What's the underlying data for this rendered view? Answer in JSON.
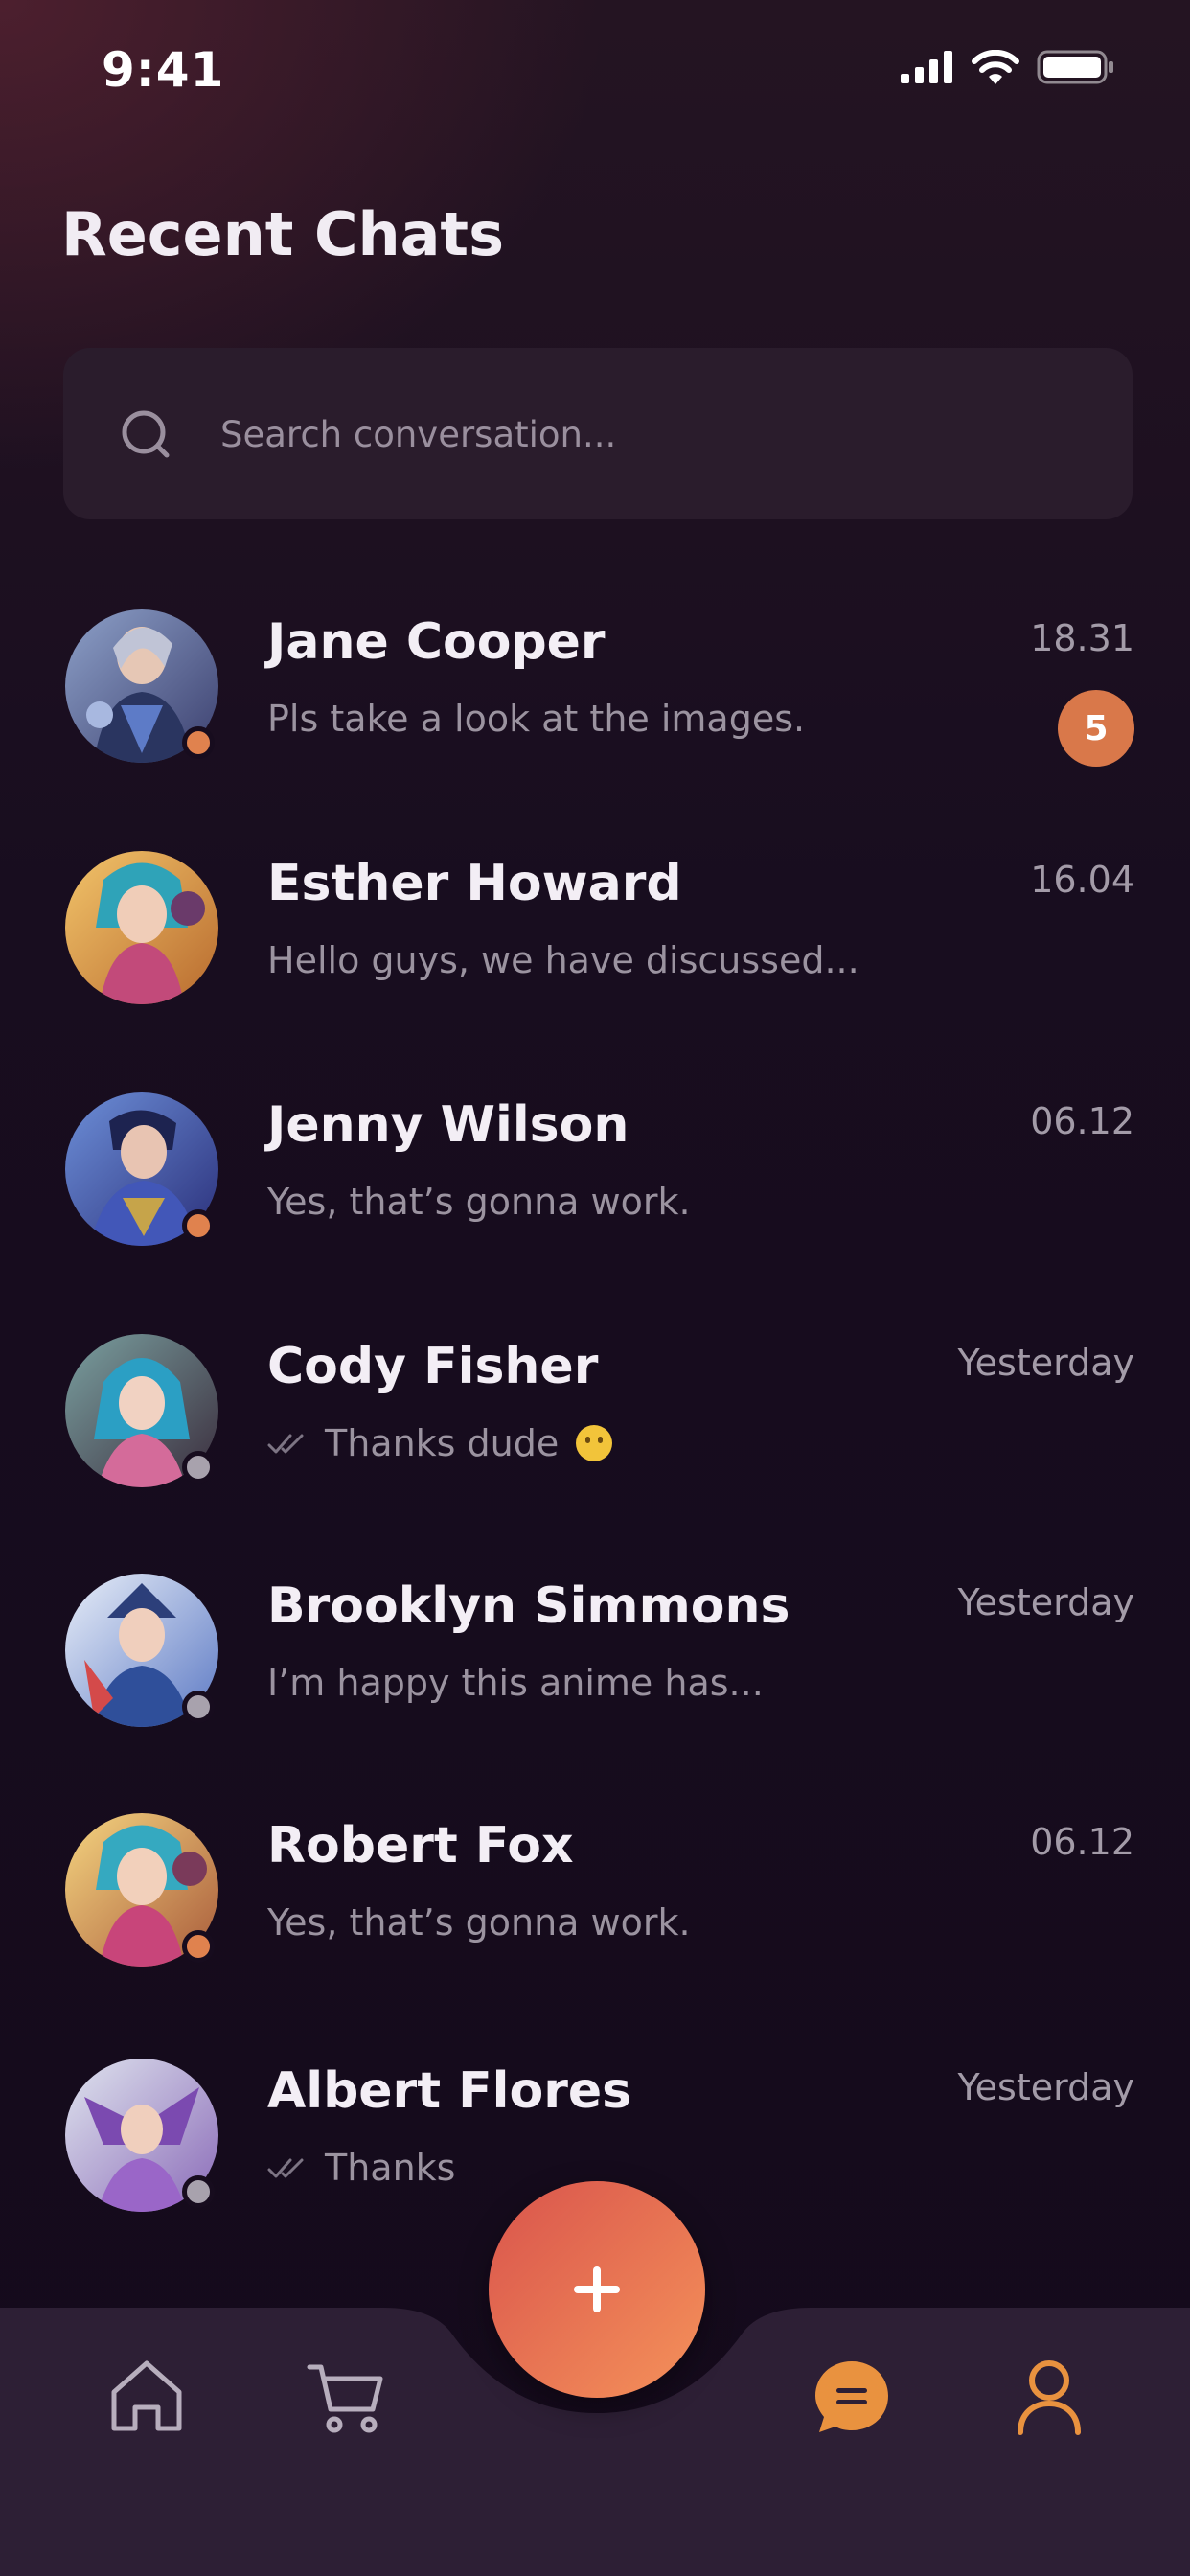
{
  "status_bar": {
    "time": "9:41"
  },
  "header": {
    "title": "Recent Chats"
  },
  "search": {
    "placeholder": "Search conversation..."
  },
  "chats": [
    {
      "name": "Jane Cooper",
      "message": "Pls take a look at the images.",
      "time": "18.31",
      "unread": "5",
      "presence": "online",
      "read_receipt": false
    },
    {
      "name": "Esther Howard",
      "message": "Hello guys, we have discussed...",
      "time": "16.04",
      "presence": "none",
      "read_receipt": false
    },
    {
      "name": "Jenny Wilson",
      "message": "Yes, that’s gonna work.",
      "time": "06.12",
      "presence": "online",
      "read_receipt": false
    },
    {
      "name": "Cody Fisher",
      "message": "Thanks dude",
      "time": "Yesterday",
      "presence": "offline",
      "read_receipt": true,
      "emoji": "smiling-face-icon"
    },
    {
      "name": "Brooklyn Simmons",
      "message": "I’m happy this anime has...",
      "time": "Yesterday",
      "presence": "offline",
      "read_receipt": false
    },
    {
      "name": "Robert Fox",
      "message": "Yes, that’s gonna work.",
      "time": "06.12",
      "presence": "online",
      "read_receipt": false
    },
    {
      "name": "Albert Flores",
      "message": "Thanks",
      "time": "Yesterday",
      "presence": "offline",
      "read_receipt": true
    }
  ],
  "tabbar": {
    "items": [
      {
        "icon": "home-icon",
        "active": false
      },
      {
        "icon": "cart-icon",
        "active": false
      },
      {
        "icon": "chat-icon",
        "active": true
      },
      {
        "icon": "profile-icon",
        "active": true
      }
    ],
    "fab_icon": "plus-icon"
  },
  "colors": {
    "accent": "#e0824e",
    "fab_start": "#d9544c",
    "fab_end": "#f5925a",
    "background": "#140a1b",
    "tabbar": "#2d1f35",
    "search_bg": "#2a1c2c",
    "offline": "#a8a2ad"
  }
}
